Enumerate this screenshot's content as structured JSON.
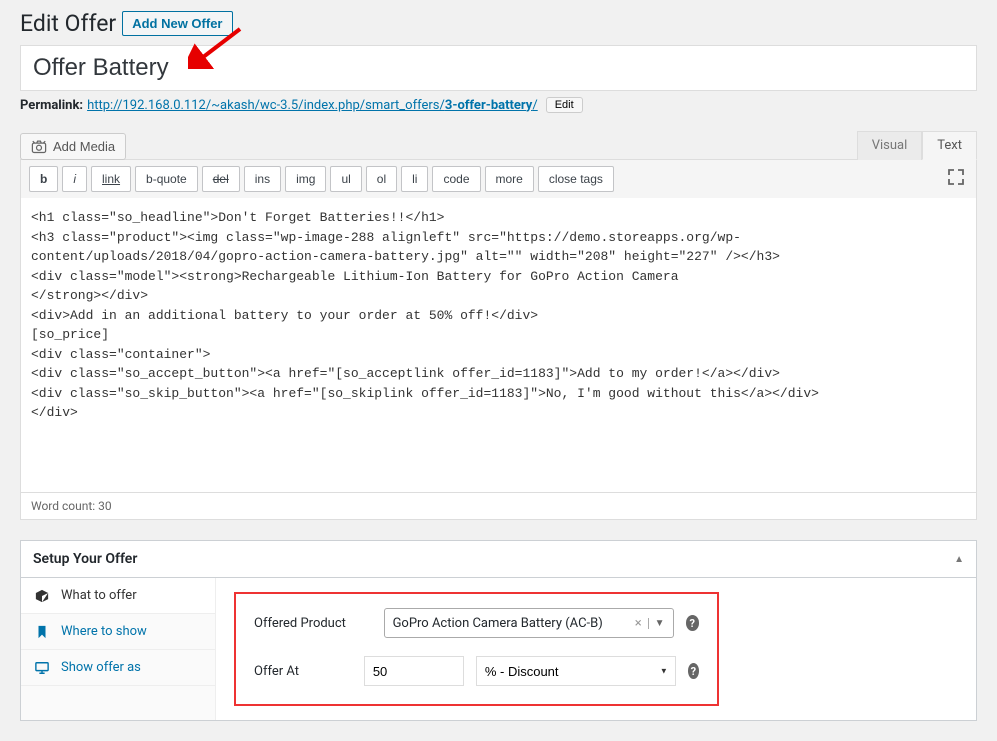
{
  "header": {
    "page_title": "Edit Offer",
    "add_new_label": "Add New Offer"
  },
  "post": {
    "title": "Offer Battery",
    "permalink_label": "Permalink:",
    "permalink_base": "http://192.168.0.112/~akash/wc-3.5/index.php/smart_offers/",
    "permalink_slug": "3-offer-battery",
    "permalink_edit_label": "Edit"
  },
  "editor": {
    "add_media_label": "Add Media",
    "tabs": {
      "visual": "Visual",
      "text": "Text"
    },
    "buttons": {
      "b": "b",
      "i": "i",
      "link": "link",
      "bquote": "b-quote",
      "del": "del",
      "ins": "ins",
      "img": "img",
      "ul": "ul",
      "ol": "ol",
      "li": "li",
      "code": "code",
      "more": "more",
      "close": "close tags"
    },
    "content": "<h1 class=\"so_headline\">Don't Forget Batteries!!</h1>\n<h3 class=\"product\"><img class=\"wp-image-288 alignleft\" src=\"https://demo.storeapps.org/wp-content/uploads/2018/04/gopro-action-camera-battery.jpg\" alt=\"\" width=\"208\" height=\"227\" /></h3>\n<div class=\"model\"><strong>Rechargeable Lithium-Ion Battery for GoPro Action Camera\n</strong></div>\n<div>Add in an additional battery to your order at 50% off!</div>\n[so_price]\n<div class=\"container\">\n<div class=\"so_accept_button\"><a href=\"[so_acceptlink offer_id=1183]\">Add to my order!</a></div>\n<div class=\"so_skip_button\"><a href=\"[so_skiplink offer_id=1183]\">No, I'm good without this</a></div>\n</div>",
    "word_count_label": "Word count: 30"
  },
  "metabox": {
    "title": "Setup Your Offer",
    "sidebar": {
      "what_to_offer": "What to offer",
      "where_to_show": "Where to show",
      "show_offer_as": "Show offer as"
    },
    "fields": {
      "offered_product_label": "Offered Product",
      "offered_product_value": "GoPro Action Camera Battery (AC-B)",
      "offer_at_label": "Offer At",
      "offer_at_value": "50",
      "offer_at_unit": "% - Discount"
    }
  }
}
